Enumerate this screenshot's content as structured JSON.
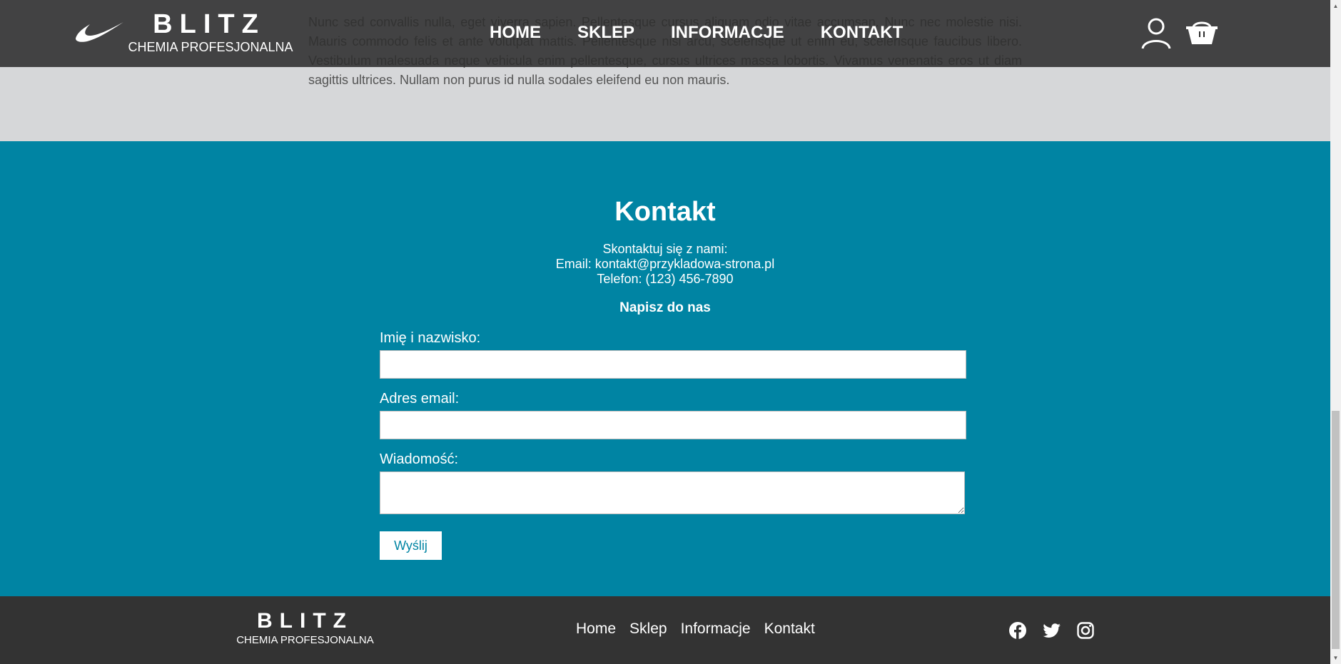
{
  "brand": {
    "title": "BLITZ",
    "subtitle": "CHEMIA PROFESJONALNA"
  },
  "nav": [
    "HOME",
    "SKLEP",
    "INFORMACJE",
    "KONTAKT"
  ],
  "header_icons": [
    "user-icon",
    "cart-icon"
  ],
  "about": {
    "text": "Nunc sed convallis nulla, eget viverra sapien. Pellentesque cursus aliquam odio vitae accumsan. Nunc nec molestie nisi. Mauris commodo felis et ante volutpat mattis. Pellentesque nisi arcu, scelerisque ut enim eu, scelerisque faucibus libero. Vestibulum malesuada neque vehicula enim pellentesque, cursus ultrices massa lobortis. Vivamus venenatis eros ut diam sagittis ultrices. Nullam non purus id nulla sodales eleifend eu non mauris."
  },
  "contact": {
    "heading": "Kontakt",
    "intro": "Skontaktuj się z nami:",
    "email": "Email: kontakt@przykladowa-strona.pl",
    "phone": "Telefon: (123) 456-7890",
    "form_heading": "Napisz do nas",
    "name_label": "Imię i nazwisko:",
    "name_value": "",
    "email_label": "Adres email:",
    "email_value": "",
    "message_label": "Wiadomość:",
    "message_value": "",
    "submit_label": "Wyślij"
  },
  "footer": {
    "title": "BLITZ",
    "subtitle": "CHEMIA PROFESJONALNA",
    "links": [
      "Home",
      "Sklep",
      "Informacje",
      "Kontakt"
    ],
    "social": [
      "facebook-icon",
      "twitter-icon",
      "instagram-icon"
    ]
  },
  "colors": {
    "header_bg": "#2d2d2d",
    "section_bg": "#d6d7d9",
    "contact_bg": "#0084a3",
    "footer_bg": "#333333",
    "text_light": "#ffffff"
  }
}
